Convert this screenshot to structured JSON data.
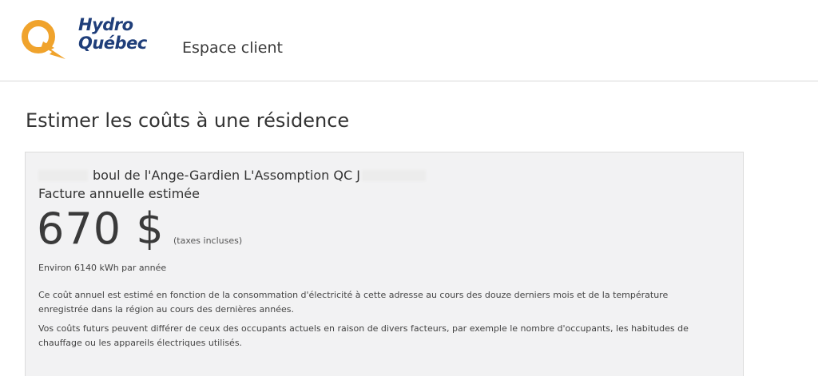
{
  "header": {
    "logo": {
      "line1": "Hydro",
      "line2": "Québec",
      "color": "#1f3e7a",
      "accent": "#f0a32c"
    },
    "app_title": "Espace client"
  },
  "page": {
    "title": "Estimer les coûts à une résidence"
  },
  "estimate": {
    "address": "boul de l'Ange-Gardien L'Assomption QC J",
    "annual_label": "Facture annuelle estimée",
    "amount": "670 $",
    "taxes_note": "(taxes incluses)",
    "consumption": "Environ 6140 kWh par année",
    "paragraphs": [
      "Ce coût annuel est estimé en fonction de la consommation d'électricité à cette adresse au cours des douze derniers mois et de la température enregistrée dans la région au cours des dernières années.",
      "Vos coûts futurs peuvent différer de ceux des occupants actuels en raison de divers facteurs, par exemple le nombre d'occupants, les habitudes de chauffage ou les appareils électriques utilisés."
    ]
  }
}
